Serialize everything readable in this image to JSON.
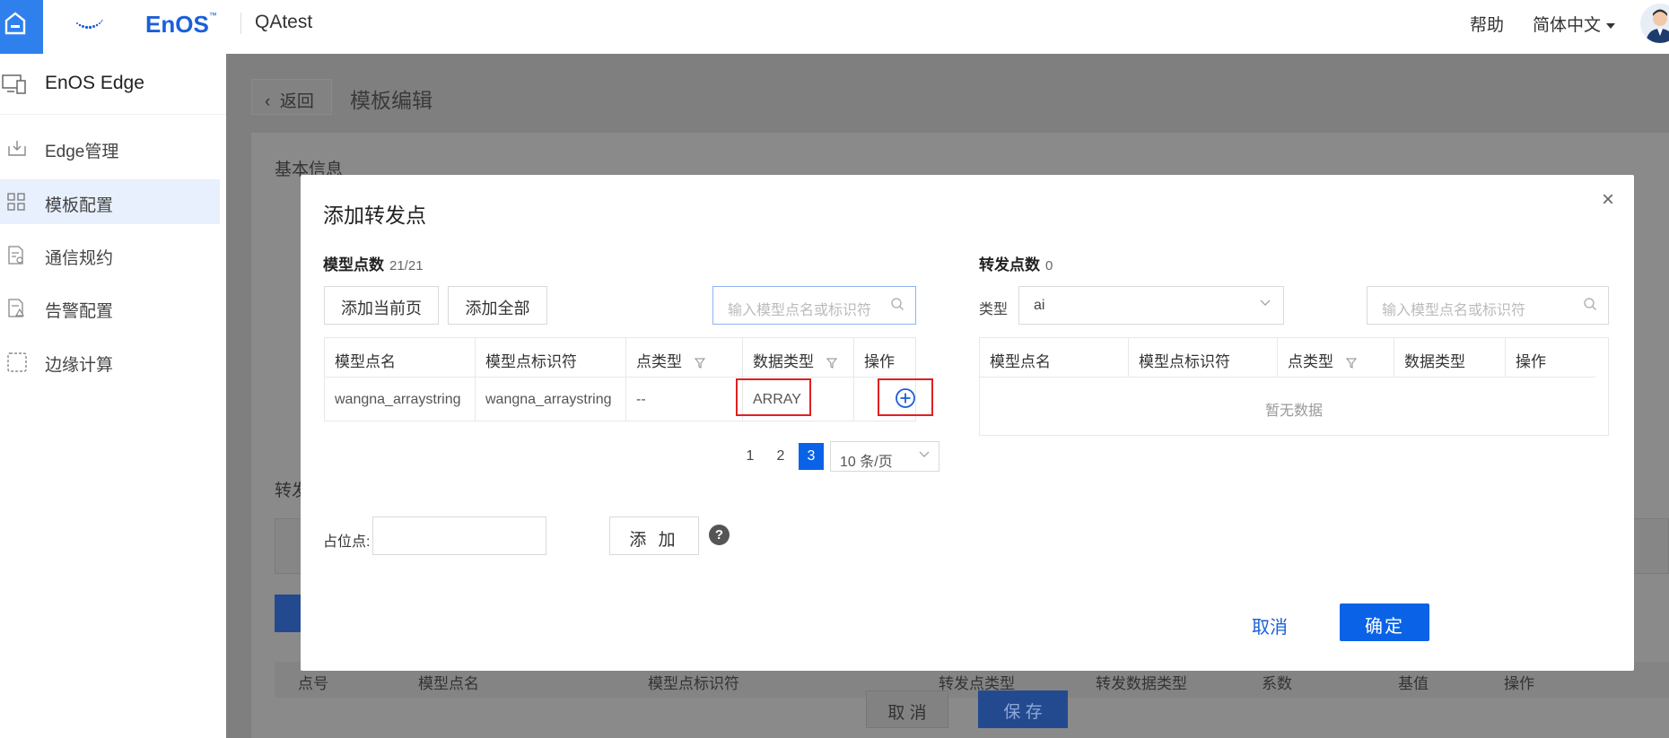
{
  "header": {
    "logo_text": "EnOS",
    "logo_tm": "™",
    "app_name": "QAtest",
    "help": "帮助",
    "language": "简体中文"
  },
  "sidebar": {
    "title": "EnOS Edge",
    "items": [
      {
        "label": "Edge管理",
        "icon": "download-box-icon"
      },
      {
        "label": "模板配置",
        "icon": "grid-icon",
        "active": true
      },
      {
        "label": "通信规约",
        "icon": "document-gear-icon"
      },
      {
        "label": "告警配置",
        "icon": "document-alert-icon"
      },
      {
        "label": "边缘计算",
        "icon": "dashed-square-icon"
      }
    ]
  },
  "background": {
    "back_label": "返回",
    "page_title": "模板编辑",
    "basic_info": "基本信息",
    "section_label": "转发",
    "columns": [
      "点号",
      "模型点名",
      "模型点标识符",
      "转发点类型",
      "转发数据类型",
      "系数",
      "基值",
      "操作"
    ],
    "cancel": "取 消",
    "save": "保 存"
  },
  "modal": {
    "title": "添加转发点",
    "left": {
      "title": "模型点数",
      "count": "21/21",
      "add_current_page": "添加当前页",
      "add_all": "添加全部",
      "search_placeholder": "输入模型点名或标识符",
      "columns": [
        "模型点名",
        "模型点标识符",
        "点类型",
        "数据类型",
        "操作"
      ],
      "rows": [
        {
          "name": "wangna_arraystring",
          "identifier": "wangna_arraystring",
          "point_type": "--",
          "data_type": "ARRAY"
        }
      ],
      "pagination": {
        "pages": [
          "1",
          "2",
          "3"
        ],
        "current": "3",
        "page_size": "10 条/页"
      },
      "placeholder_label": "占位点:",
      "add_button": "添 加",
      "help_icon": "?"
    },
    "right": {
      "title": "转发点数",
      "count": "0",
      "type_label": "类型",
      "type_value": "ai",
      "search_placeholder": "输入模型点名或标识符",
      "columns": [
        "模型点名",
        "模型点标识符",
        "点类型",
        "数据类型",
        "操作"
      ],
      "empty_text": "暂无数据"
    },
    "cancel": "取消",
    "confirm": "确定"
  },
  "colors": {
    "accent": "#0a63e6",
    "highlight": "#e02020",
    "mask": "#7f7f7f"
  }
}
